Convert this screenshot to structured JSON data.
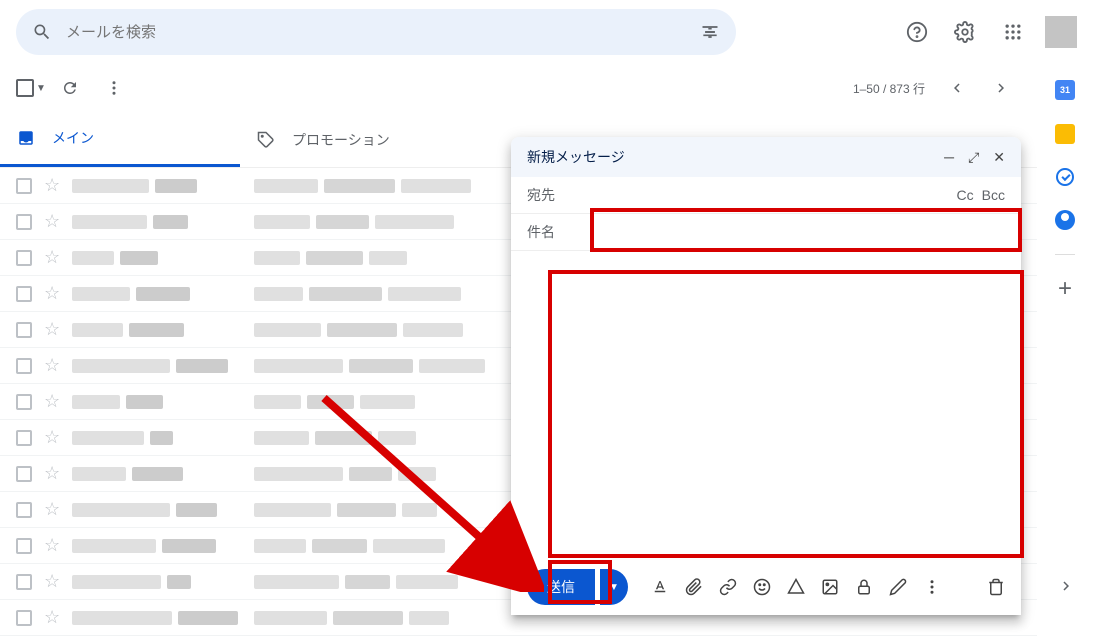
{
  "header": {
    "search_placeholder": "メールを検索"
  },
  "toolbar": {
    "pagination": "1–50 / 873 行"
  },
  "tabs": {
    "main": "メイン",
    "promotions": "プロモーション"
  },
  "compose": {
    "title": "新規メッセージ",
    "to_label": "宛先",
    "cc": "Cc",
    "bcc": "Bcc",
    "subject_label": "件名",
    "send_label": "送信"
  },
  "side": {
    "calendar_date": "31"
  }
}
